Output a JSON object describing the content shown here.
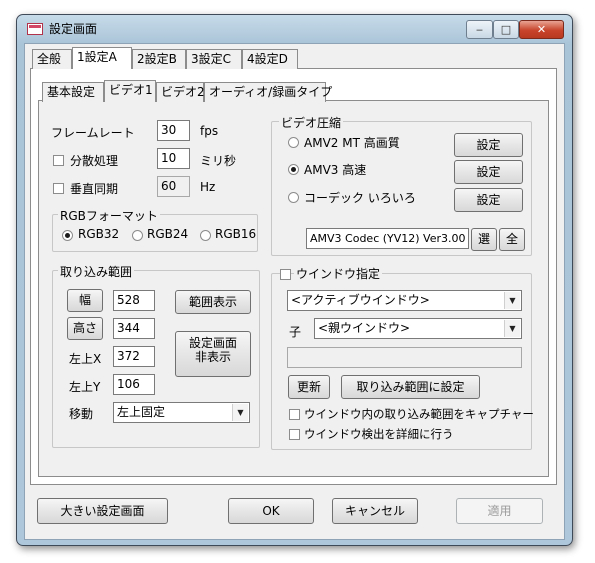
{
  "window": {
    "title": "設定画面",
    "min_label": "‒",
    "max_label": "□",
    "close_label": "✕"
  },
  "tabs_top": [
    "全般",
    "1設定A",
    "2設定B",
    "3設定C",
    "4設定D"
  ],
  "tabs_sub": [
    "基本設定",
    "ビデオ1",
    "ビデオ2",
    "オーディオ/録画タイプ"
  ],
  "framerate": {
    "framerate_label": "フレームレート",
    "framerate_value": "30",
    "framerate_unit": "fps",
    "distributed_label": "分散処理",
    "distributed_value": "10",
    "distributed_unit": "ミリ秒",
    "vsync_label": "垂直同期",
    "vsync_value": "60",
    "vsync_unit": "Hz"
  },
  "rgb_format": {
    "legend": "RGBフォーマット",
    "options": [
      "RGB32",
      "RGB24",
      "RGB16"
    ],
    "selected": "RGB32"
  },
  "video_compression": {
    "legend": "ビデオ圧縮",
    "options": [
      "AMV2 MT 高画質",
      "AMV3 高速",
      "コーデック いろいろ"
    ],
    "selected": "AMV3 高速",
    "settings_label": "設定",
    "codec_value": "AMV3 Codec (YV12) Ver3.00",
    "select_label": "選",
    "all_label": "全"
  },
  "capture_range": {
    "legend": "取り込み範囲",
    "width_label": "幅",
    "width_value": "528",
    "height_label": "高さ",
    "height_value": "344",
    "left_label": "左上X",
    "left_value": "372",
    "top_label": "左上Y",
    "top_value": "106",
    "move_label": "移動",
    "move_value": "左上固定",
    "show_range_label": "範囲表示",
    "hide_settings_line1": "設定画面",
    "hide_settings_line2": "非表示"
  },
  "window_spec": {
    "legend": "ウインドウ指定",
    "active_window": "<アクティブウインドウ>",
    "child_label": "子",
    "parent_window": "<親ウインドウ>",
    "text_value": "",
    "refresh_label": "更新",
    "set_range_label": "取り込み範囲に設定",
    "capture_in_window_label": "ウインドウ内の取り込み範囲をキャプチャー",
    "detailed_detect_label": "ウインドウ検出を詳細に行う"
  },
  "footer": {
    "large_label": "大きい設定画面",
    "ok_label": "OK",
    "cancel_label": "キャンセル",
    "apply_label": "適用"
  }
}
